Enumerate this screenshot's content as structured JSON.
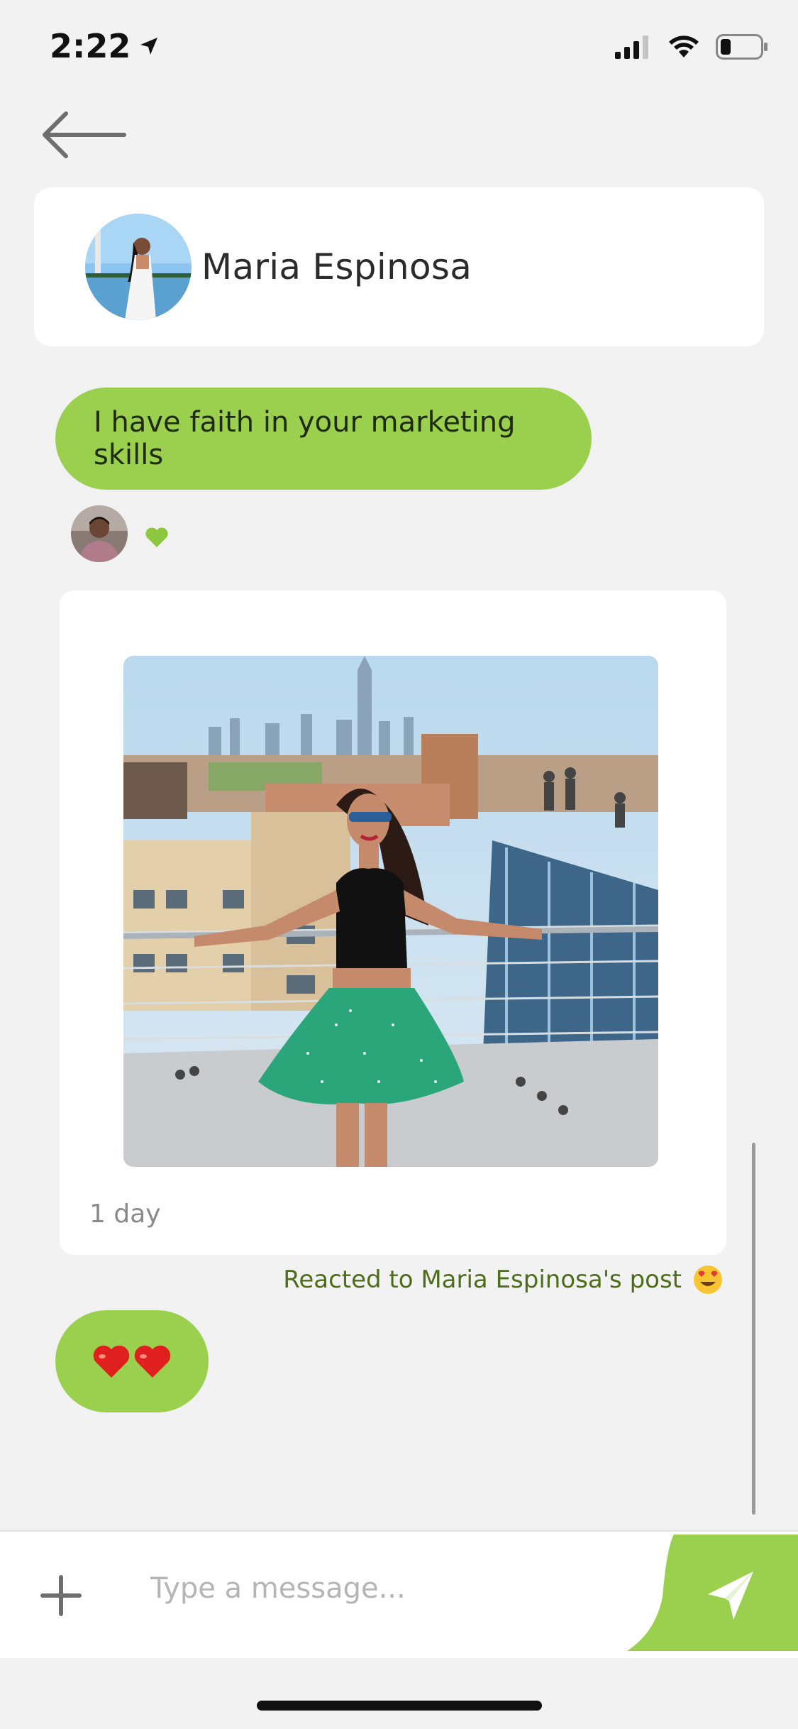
{
  "status_bar": {
    "time": "2:22"
  },
  "navigation": {
    "back_icon": "arrow-left-icon"
  },
  "contact": {
    "name": "Maria Espinosa"
  },
  "messages": {
    "text_message": "I have faith in your marketing skills",
    "reaction_icon": "heart-icon",
    "shared_post_age": "1 day",
    "reacted_note": "Reacted to Maria Espinosa's post",
    "reacted_emoji": "heart-eyes-emoji",
    "hearts_message": "❤️❤️"
  },
  "composer": {
    "placeholder": "Type a message...",
    "add_icon": "plus-icon",
    "send_icon": "send-icon"
  },
  "colors": {
    "accent": "#9bd04f",
    "background": "#f2f2f2",
    "card": "#ffffff",
    "note_text": "#4d6d18"
  }
}
